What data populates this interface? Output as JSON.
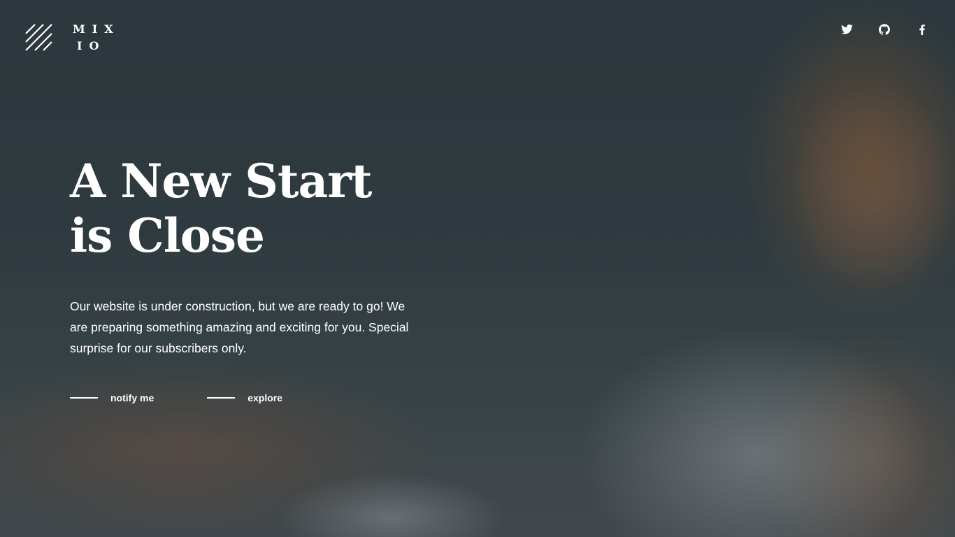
{
  "brand": {
    "logo_line1": "MIX",
    "logo_line2": "IO"
  },
  "social": [
    {
      "name": "twitter-icon"
    },
    {
      "name": "github-icon"
    },
    {
      "name": "facebook-icon"
    }
  ],
  "hero": {
    "title_line1": "A New Start",
    "title_line2": "is Close",
    "description": "Our website is under construction, but we are ready to go! We are preparing something amazing and exciting for you. Special surprise for our subscribers only."
  },
  "actions": {
    "notify_label": "notify me",
    "explore_label": "explore"
  },
  "colors": {
    "text": "#ffffff",
    "background": "#2f3a3f"
  }
}
